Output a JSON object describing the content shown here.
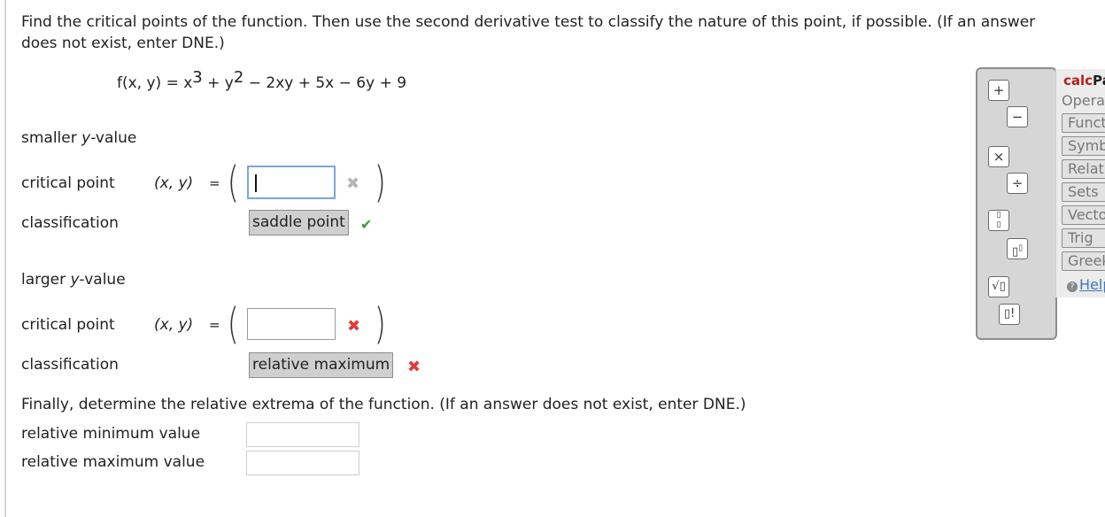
{
  "prompt": "Find the critical points of the function. Then use the second derivative test to classify the nature of this point, if possible. (If an answer does not exist, enter DNE.)",
  "function": {
    "lhs": "f(x, y) = x",
    "exp1": "3",
    "mid": " + y",
    "exp2": "2",
    "rest": " − 2xy + 5x − 6y + 9"
  },
  "smaller": {
    "heading_prefix": "smaller ",
    "heading_var": "y",
    "heading_suffix": "-value",
    "cp_label": "critical point",
    "xy_label": "(x, y)",
    "equals": "=",
    "open_paren": "(",
    "close_paren": ")",
    "cp_value": "",
    "cp_mark": "✖",
    "class_label": "classification",
    "class_value": "saddle point",
    "class_mark": "✔"
  },
  "larger": {
    "heading_prefix": "larger ",
    "heading_var": "y",
    "heading_suffix": "-value",
    "cp_label": "critical point",
    "xy_label": "(x, y)",
    "equals": "=",
    "open_paren": "(",
    "close_paren": ")",
    "cp_value": "",
    "cp_mark": "✖",
    "class_label": "classification",
    "class_value": "relative maximum",
    "class_mark": "✖"
  },
  "extrema": {
    "prompt": "Finally, determine the relative extrema of the function. (If an answer does not exist, enter DNE.)",
    "min_label": "relative minimum value",
    "max_label": "relative maximum value",
    "min_value": "",
    "max_value": ""
  },
  "palette": {
    "plus": "+",
    "minus": "−",
    "times": "×",
    "divide": "÷",
    "fraction": "▯/▯",
    "power": "▯▯",
    "sqrt": "√▯",
    "factorial": "▯!"
  },
  "calcpad": {
    "title_red": "calc",
    "title_rest": "Pad",
    "operations": "Operations",
    "tabs": [
      "Functions",
      "Symbols",
      "Relations",
      "Sets",
      "Vectors",
      "Trig",
      "Greek"
    ],
    "help": "Help"
  }
}
